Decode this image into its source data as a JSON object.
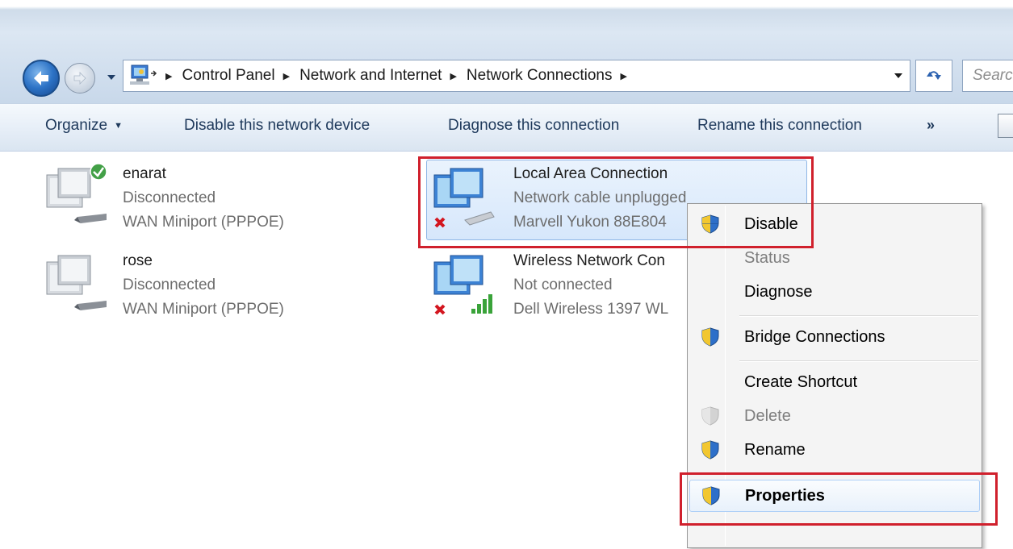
{
  "address_bar": {
    "breadcrumbs": [
      "Control Panel",
      "Network and Internet",
      "Network Connections"
    ],
    "search_placeholder": "Search"
  },
  "toolbar": {
    "organize": "Organize",
    "disable_device": "Disable this network device",
    "diagnose": "Diagnose this connection",
    "rename": "Rename this connection",
    "more": "»"
  },
  "connections": [
    {
      "name": "enarat",
      "state": "Disconnected",
      "device": "WAN Miniport (PPPOE)",
      "status": "connected-check"
    },
    {
      "name": "rose",
      "state": "Disconnected",
      "device": "WAN Miniport (PPPOE)",
      "status": "none"
    },
    {
      "name": "Local Area Connection",
      "state": "Network cable unplugged",
      "device": "Marvell Yukon 88E804",
      "status": "error-x"
    },
    {
      "name": "Wireless Network Con",
      "state": "Not connected",
      "device": "Dell Wireless 1397 WL",
      "status": "error-x"
    }
  ],
  "context_menu": {
    "items": [
      {
        "label": "Disable",
        "shield": true,
        "enabled": true
      },
      {
        "label": "Status",
        "shield": false,
        "enabled": false
      },
      {
        "label": "Diagnose",
        "shield": false,
        "enabled": true
      },
      {
        "label": "Bridge Connections",
        "shield": true,
        "enabled": true
      },
      {
        "label": "Create Shortcut",
        "shield": false,
        "enabled": true
      },
      {
        "label": "Delete",
        "shield": true,
        "enabled": false
      },
      {
        "label": "Rename",
        "shield": true,
        "enabled": true
      },
      {
        "label": "Properties",
        "shield": true,
        "enabled": true,
        "bold": true
      }
    ]
  },
  "colors": {
    "highlight_red": "#d0202c",
    "selection_blue": "#d6e7fb",
    "toolbar_text": "#1e395b"
  }
}
